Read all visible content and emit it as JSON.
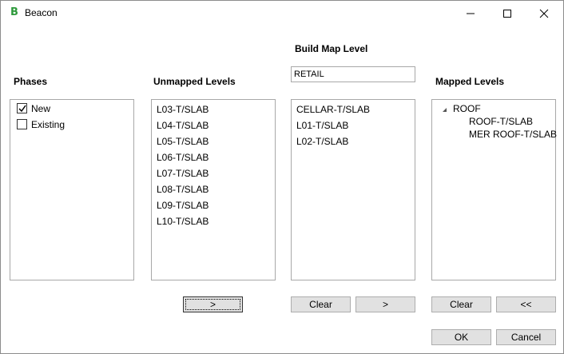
{
  "window": {
    "title": "Beacon",
    "app_icon_letter": "B",
    "controls": {
      "minimize": "minimize-icon",
      "maximize": "maximize-icon",
      "close": "close-icon"
    }
  },
  "phases": {
    "label": "Phases",
    "items": [
      {
        "label": "New",
        "checked": true
      },
      {
        "label": "Existing",
        "checked": false
      }
    ]
  },
  "unmapped": {
    "label": "Unmapped Levels",
    "items": [
      "L03-T/SLAB",
      "L04-T/SLAB",
      "L05-T/SLAB",
      "L06-T/SLAB",
      "L07-T/SLAB",
      "L08-T/SLAB",
      "L09-T/SLAB",
      "L10-T/SLAB"
    ],
    "move_button": ">"
  },
  "build": {
    "label": "Build Map Level",
    "name_value": "RETAIL",
    "items": [
      "CELLAR-T/SLAB",
      "L01-T/SLAB",
      "L02-T/SLAB"
    ],
    "clear_button": "Clear",
    "move_button": ">"
  },
  "mapped": {
    "label": "Mapped Levels",
    "tree": {
      "node": "ROOF",
      "expanded": true,
      "children": [
        "ROOF-T/SLAB",
        "MER ROOF-T/SLAB"
      ]
    },
    "clear_button": "Clear",
    "back_button": "<<"
  },
  "footer": {
    "ok_button": "OK",
    "cancel_button": "Cancel"
  }
}
